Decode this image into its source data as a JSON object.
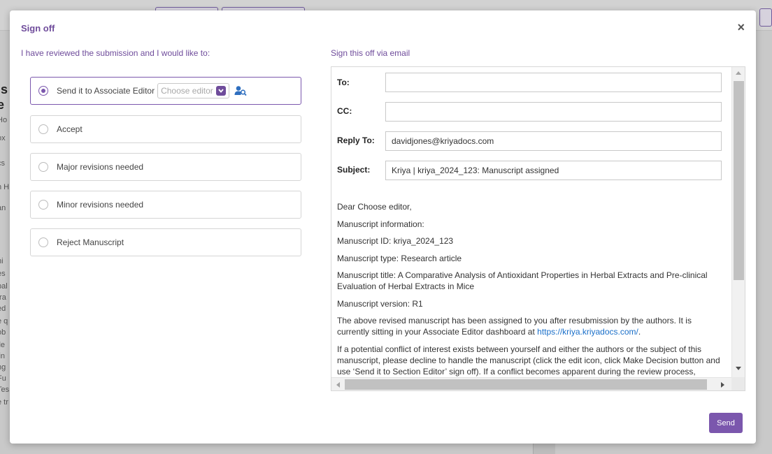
{
  "background": {
    "left_text": [
      {
        "text": "is",
        "big": true
      },
      {
        "text": "e",
        "big": true
      },
      {
        "text": "Ho"
      },
      {
        "text": "ox"
      },
      {
        "text": "cs"
      },
      {
        "text": "n H"
      },
      {
        "text": "an"
      },
      {
        "text": "ni"
      },
      {
        "text": "es"
      },
      {
        "text": "pal"
      },
      {
        "text": "tra"
      },
      {
        "text": "ed"
      },
      {
        "text": "e q"
      },
      {
        "text": "ob"
      },
      {
        "text": "ile"
      },
      {
        "text": "lin"
      },
      {
        "text": "ng"
      },
      {
        "text": "Fu"
      },
      {
        "text": "Tes"
      },
      {
        "text": "e tr"
      }
    ]
  },
  "modal": {
    "title": "Sign off",
    "close_glyph": "×",
    "left_heading": "I have reviewed the submission and I would like to:",
    "right_heading": "Sign this off via email",
    "options": [
      {
        "label": "Send it to Associate Editor",
        "selected": true
      },
      {
        "label": "Accept",
        "selected": false
      },
      {
        "label": "Major revisions needed",
        "selected": false
      },
      {
        "label": "Minor revisions needed",
        "selected": false
      },
      {
        "label": "Reject Manuscript",
        "selected": false
      }
    ],
    "editor_select": {
      "placeholder": "Choose editor",
      "icon": "chevron-down-icon"
    },
    "user_search_icon": "user-search-icon",
    "email": {
      "to_label": "To:",
      "to_value": "",
      "cc_label": "CC:",
      "cc_value": "",
      "reply_to_label": "Reply To:",
      "reply_to_value": "davidjones@kriyadocs.com",
      "subject_label": "Subject:",
      "subject_value": "Kriya | kriya_2024_123: Manuscript assigned",
      "body": {
        "greeting": "Dear Choose editor,",
        "info_heading": "Manuscript information:",
        "ms_id": "Manuscript ID: kriya_2024_123",
        "ms_type": "Manuscript type: Research article",
        "ms_title": "Manuscript title: A Comparative Analysis of Antioxidant Properties in Herbal Extracts and Pre-clinical Evaluation of Herbal Extracts in Mice",
        "ms_version": "Manuscript version: R1",
        "para1_text": "The above revised manuscript has been assigned to you after resubmission by the authors. It is currently sitting in your Associate Editor dashboard at ",
        "para1_link": "https://kriya.kriyadocs.com/",
        "para1_end": ".",
        "para2": "If a potential conflict of interest exists between yourself and either the authors or the subject of this manuscript, please decline to handle the manuscript (click the edit icon, click Make Decision button and use ‘Send it to Section Editor’ sign off). If a conflict becomes apparent during the review process,"
      }
    },
    "send_label": "Send"
  },
  "colors": {
    "accent": "#7b57ad",
    "heading": "#6f4c9b",
    "link": "#1a6fc9"
  }
}
